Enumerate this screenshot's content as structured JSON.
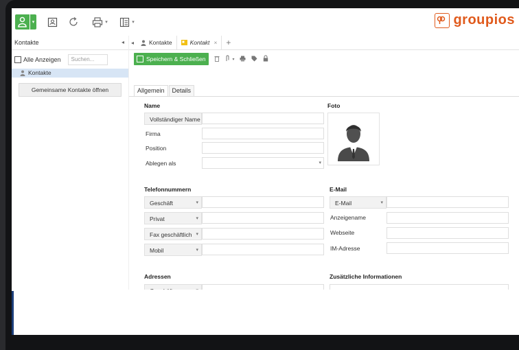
{
  "app": {
    "brand": "groupios",
    "brand_color": "#e05a1c",
    "accent_color": "#4cb04f"
  },
  "toolbar": {
    "icons": [
      "user-icon",
      "contacts-book-icon",
      "refresh-icon",
      "print-icon",
      "layout-icon"
    ]
  },
  "sidebar": {
    "header": "Kontakte",
    "filter_label": "Alle Anzeigen",
    "search_placeholder": "Suchen...",
    "items": [
      {
        "label": "Kontakte"
      }
    ],
    "open_shared_button": "Gemeinsame Kontakte öffnen"
  },
  "tabs": {
    "items": [
      {
        "label": "Kontakte"
      },
      {
        "label": "Kontakt"
      }
    ],
    "close_glyph": "×",
    "add_glyph": "+"
  },
  "actionbar": {
    "save_close": "Speichern & Schließen"
  },
  "subtabs": [
    "Allgemein",
    "Details"
  ],
  "form": {
    "name": {
      "title": "Name",
      "fullname_button": "Vollständiger Name",
      "company": "Firma",
      "position": "Position",
      "file_as": "Ablegen als"
    },
    "photo": {
      "title": "Foto"
    },
    "phone": {
      "title": "Telefonnummern",
      "types": [
        "Geschäft",
        "Privat",
        "Fax geschäftlich",
        "Mobil"
      ]
    },
    "email": {
      "title": "E-Mail",
      "type": "E-Mail",
      "display_name": "Anzeigename",
      "website": "Webseite",
      "im_address": "IM-Adresse"
    },
    "addresses": {
      "title": "Adressen",
      "type": "Geschäft"
    },
    "additional": {
      "title": "Zusätzliche Informationen"
    }
  }
}
